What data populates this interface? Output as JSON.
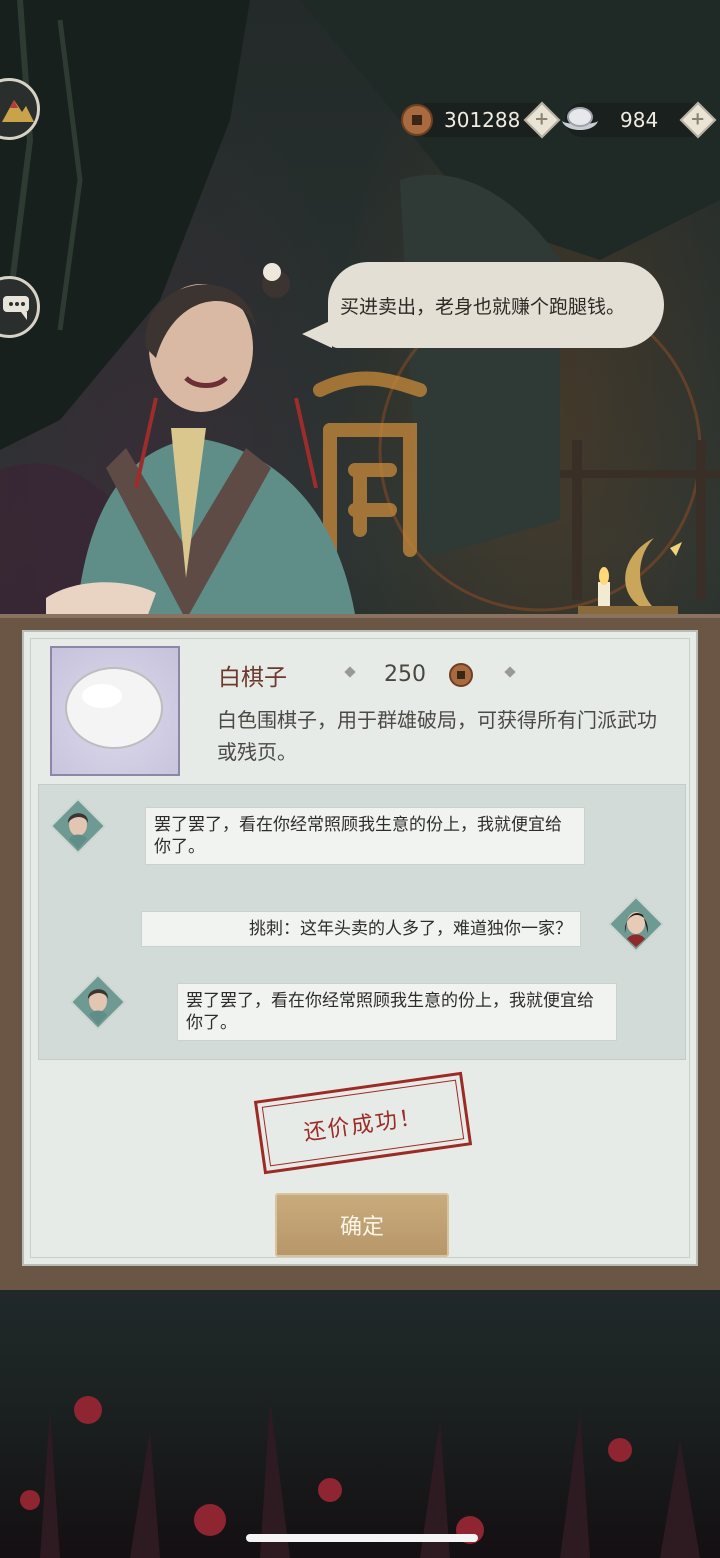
{
  "currency": {
    "copper": "301288",
    "silver": "984",
    "copper_icon": "copper-coin-icon",
    "silver_icon": "silver-ingot-icon"
  },
  "merchant": {
    "speech": "买进卖出，老身也就赚个跑腿钱。"
  },
  "item": {
    "name": "白棋子",
    "price": "250",
    "description": "白色围棋子，用于群雄破局，可获得所有门派武功或残页。"
  },
  "dialogue": [
    {
      "speaker": "merchant",
      "text": "罢了罢了，看在你经常照顾我生意的份上，我就便宜给你了。"
    },
    {
      "speaker": "player",
      "text": "挑刺：这年头卖的人多了，难道独你一家？"
    },
    {
      "speaker": "merchant",
      "text": "罢了罢了，看在你经常照顾我生意的份上，我就便宜给你了。"
    }
  ],
  "result": {
    "stamp": "还价成功！",
    "confirm_label": "确定"
  },
  "colors": {
    "panel_bg": "#e7ebe8",
    "stamp_red": "#9c2a25",
    "button_gold": "#c8ab7c",
    "item_name": "#6b3a2c"
  }
}
